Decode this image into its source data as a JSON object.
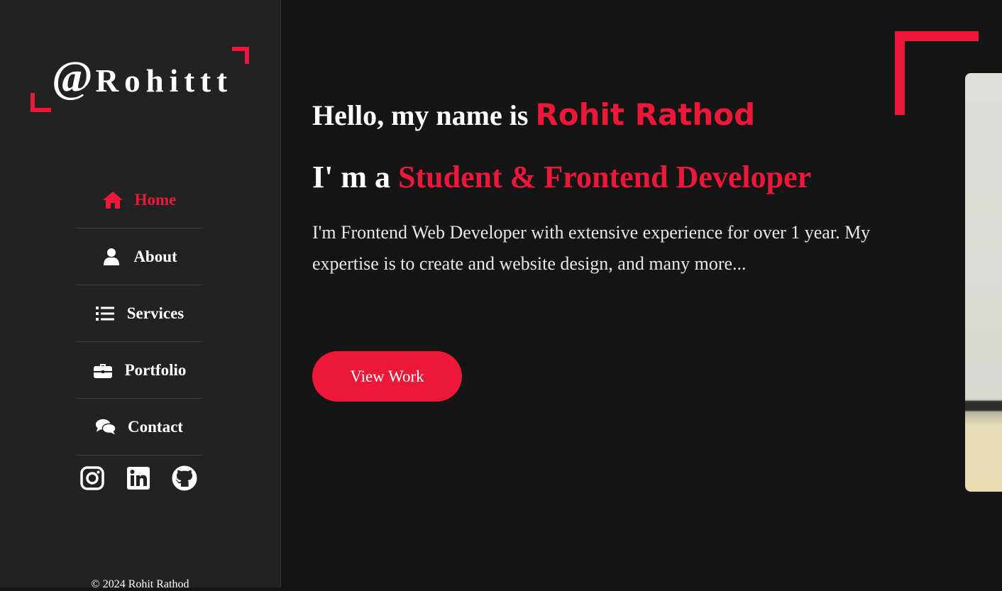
{
  "brand": {
    "at": "@",
    "name": "Rohittt"
  },
  "nav": {
    "items": [
      {
        "label": "Home",
        "icon": "home-icon",
        "active": true
      },
      {
        "label": "About",
        "icon": "user-icon",
        "active": false
      },
      {
        "label": "Services",
        "icon": "list-icon",
        "active": false
      },
      {
        "label": "Portfolio",
        "icon": "briefcase-icon",
        "active": false
      },
      {
        "label": "Contact",
        "icon": "comments-icon",
        "active": false
      }
    ]
  },
  "social": [
    "instagram-icon",
    "linkedin-icon",
    "github-icon"
  ],
  "footer": {
    "text": "© 2024 Rohit Rathod"
  },
  "hero": {
    "greeting": "Hello, my name is ",
    "name": "Rohit Rathod",
    "role_prefix": "I' m a ",
    "role": "Student & Frontend Developer",
    "description": "I'm Frontend Web Developer with extensive experience for over 1 year. My expertise is to create and website design, and many more...",
    "button": "View Work"
  },
  "colors": {
    "accent": "#ec1839",
    "sidebar_bg": "#222222",
    "page_bg": "#151515",
    "text": "#ffffff"
  }
}
